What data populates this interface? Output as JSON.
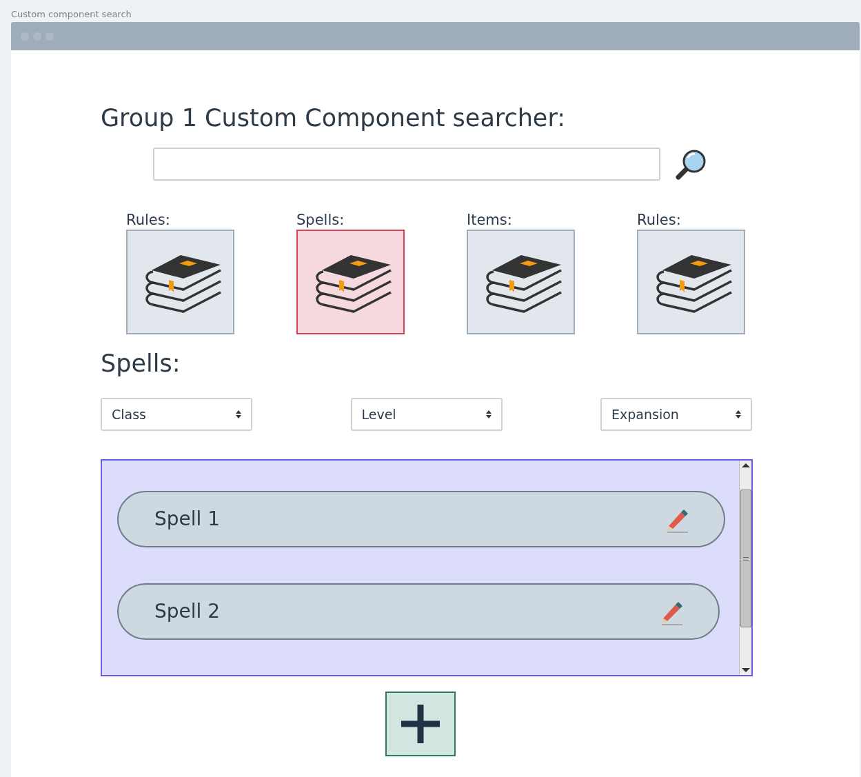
{
  "caption": "Custom component search",
  "heading": "Group 1 Custom Component searcher:",
  "categories": [
    {
      "label": "Rules:",
      "selected": false
    },
    {
      "label": "Spells:",
      "selected": true
    },
    {
      "label": "Items:",
      "selected": false
    },
    {
      "label": "Rules:",
      "selected": false
    }
  ],
  "section_title": "Spells:",
  "filters": [
    {
      "label": "Class"
    },
    {
      "label": "Level"
    },
    {
      "label": "Expansion"
    }
  ],
  "spells": [
    {
      "name": "Spell 1"
    },
    {
      "name": "Spell 2"
    }
  ]
}
